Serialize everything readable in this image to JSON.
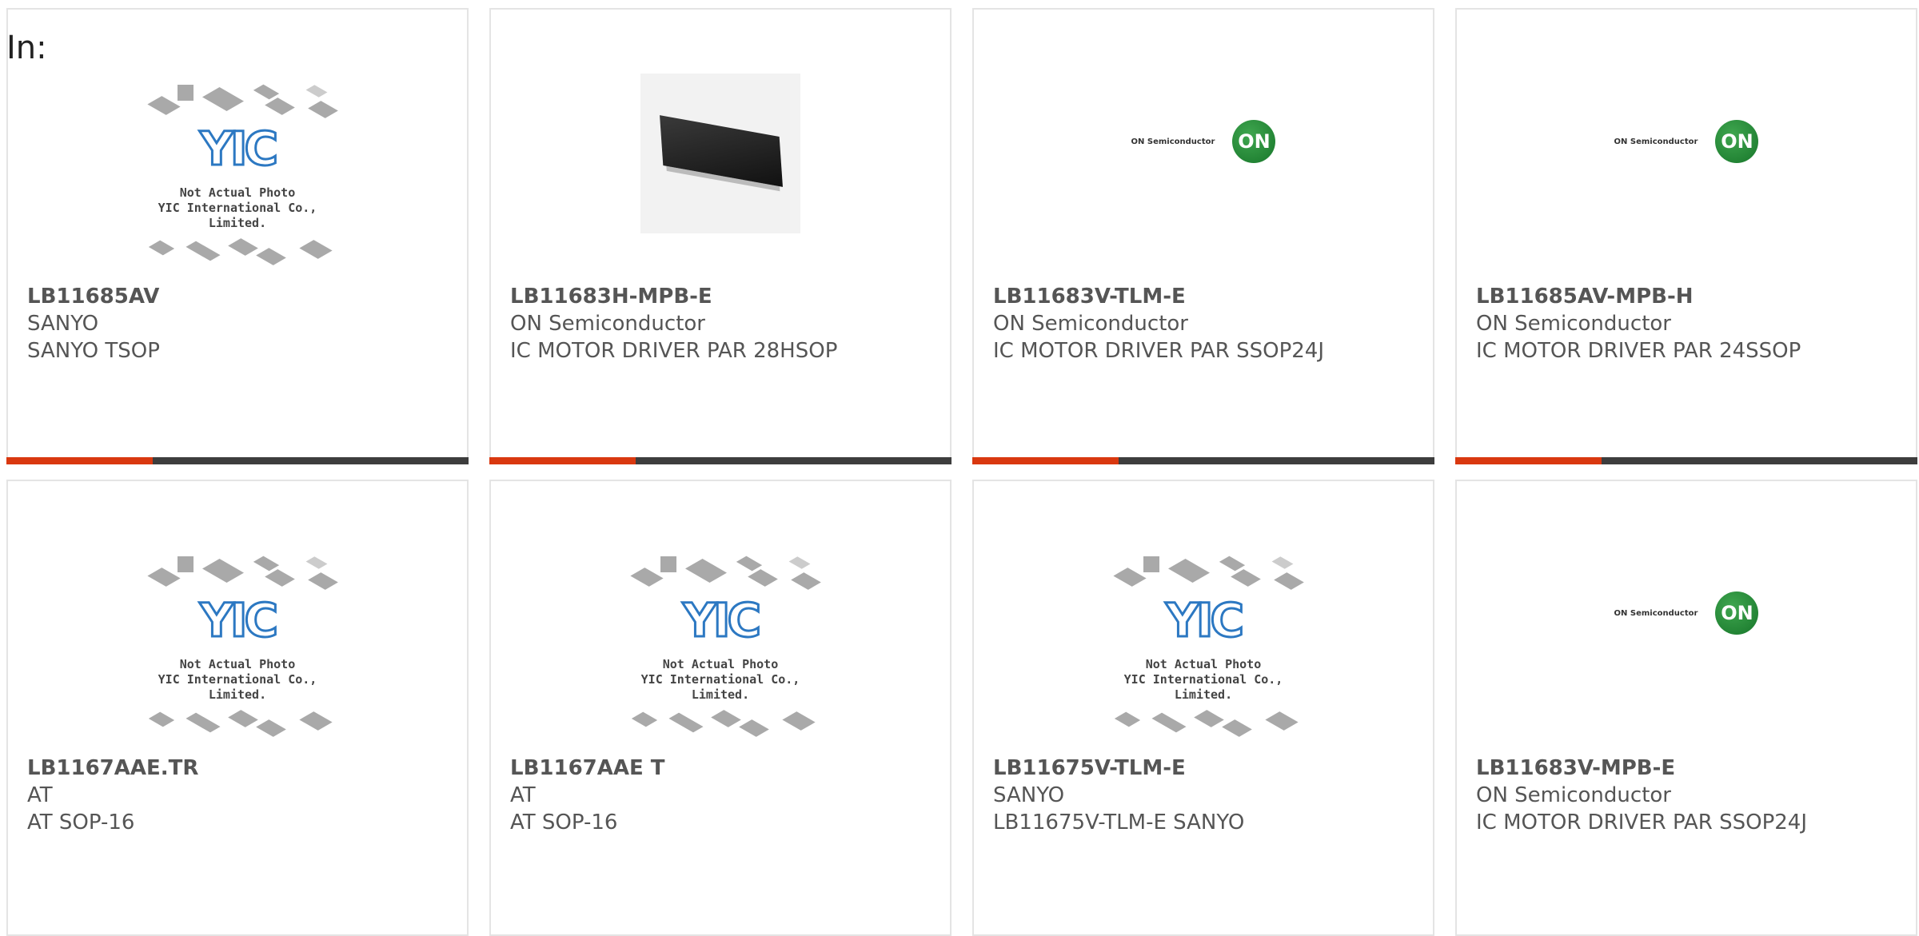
{
  "filter_label": "In:",
  "placeholder": {
    "logo_text": "YIC",
    "caption_line1": "Not Actual Photo",
    "caption_line2": "YIC International Co., Limited."
  },
  "onsemi_logo": {
    "wordmark": "ON Semiconductor",
    "badge": "ON"
  },
  "colors": {
    "accent": "#d9380f",
    "bar": "#3d3d3d",
    "logo_blue": "#2c78c2",
    "on_green": "#17762a"
  },
  "products": [
    {
      "part_number": "LB11685AV",
      "manufacturer": "SANYO",
      "description": "SANYO TSOP",
      "image": "placeholder"
    },
    {
      "part_number": "LB11683H-MPB-E",
      "manufacturer": "ON Semiconductor",
      "description": "IC MOTOR DRIVER PAR 28HSOP",
      "image": "chip-photo"
    },
    {
      "part_number": "LB11683V-TLM-E",
      "manufacturer": "ON Semiconductor",
      "description": "IC MOTOR DRIVER PAR SSOP24J",
      "image": "onsemi-logo"
    },
    {
      "part_number": "LB11685AV-MPB-H",
      "manufacturer": "ON Semiconductor",
      "description": "IC MOTOR DRIVER PAR 24SSOP",
      "image": "onsemi-logo"
    },
    {
      "part_number": "LB1167AAE.TR",
      "manufacturer": "AT",
      "description": "AT SOP-16",
      "image": "placeholder"
    },
    {
      "part_number": "LB1167AAE T",
      "manufacturer": "AT",
      "description": "AT SOP-16",
      "image": "placeholder"
    },
    {
      "part_number": "LB11675V-TLM-E",
      "manufacturer": "SANYO",
      "description": "LB11675V-TLM-E SANYO",
      "image": "placeholder"
    },
    {
      "part_number": "LB11683V-MPB-E",
      "manufacturer": "ON Semiconductor",
      "description": "IC MOTOR DRIVER PAR SSOP24J",
      "image": "onsemi-logo"
    }
  ]
}
